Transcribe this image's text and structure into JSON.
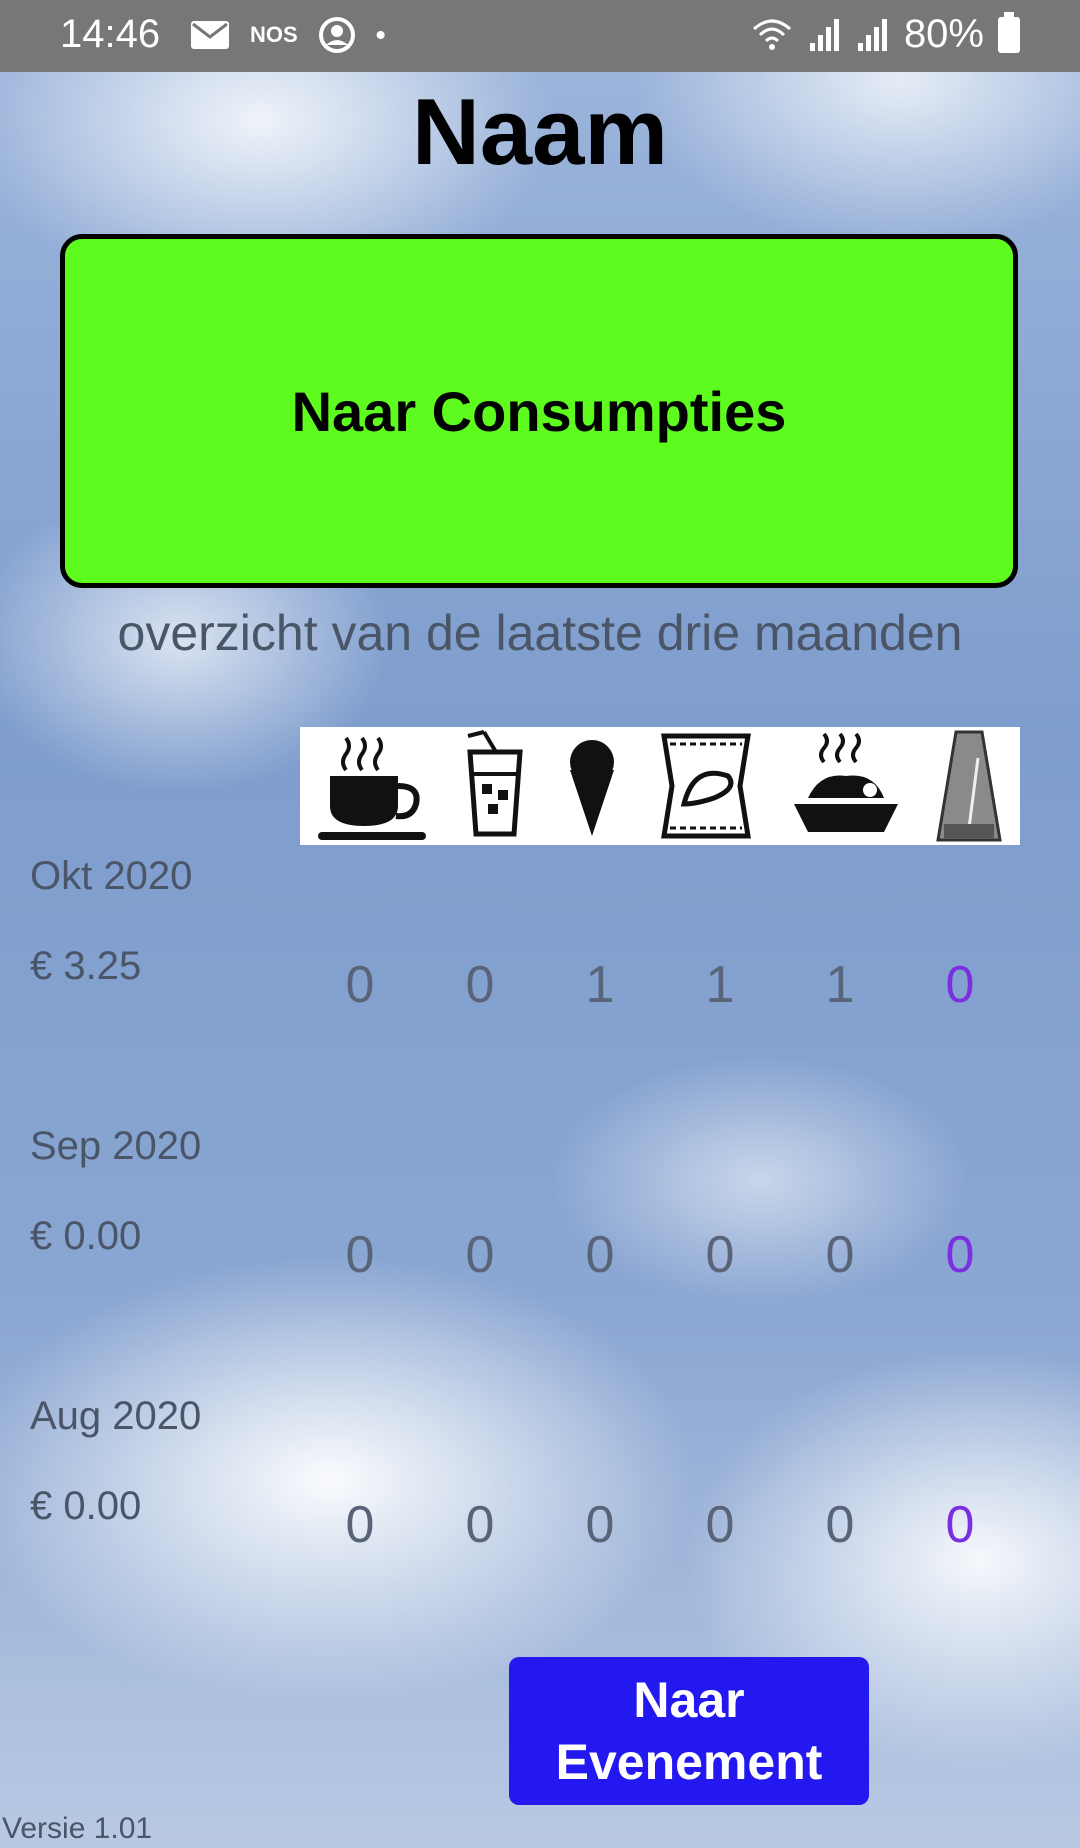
{
  "status_bar": {
    "time": "14:46",
    "carrier": "NOS",
    "battery": "80%",
    "icons": [
      "mail-icon",
      "account-circle-icon",
      "dot-icon",
      "wifi-icon",
      "signal-icon",
      "signal-icon-2",
      "battery-icon"
    ]
  },
  "header": {
    "title": "Naam"
  },
  "consumpties_button": {
    "label": "Naar Consumpties",
    "color": "#5efc1e"
  },
  "overview": {
    "subtitle": "overzicht van de laatste drie maanden",
    "categories": [
      "coffee-icon",
      "drink-icon",
      "ice-cream-icon",
      "chips-icon",
      "meal-icon",
      "metronome-icon"
    ],
    "months": [
      {
        "label": "Okt 2020",
        "amount": "€ 3.25",
        "counts": [
          "0",
          "0",
          "1",
          "1",
          "1",
          "0"
        ]
      },
      {
        "label": "Sep 2020",
        "amount": "€ 0.00",
        "counts": [
          "0",
          "0",
          "0",
          "0",
          "0",
          "0"
        ]
      },
      {
        "label": "Aug 2020",
        "amount": "€ 0.00",
        "counts": [
          "0",
          "0",
          "0",
          "0",
          "0",
          "0"
        ]
      }
    ]
  },
  "evenement_button": {
    "line1": "Naar",
    "line2": "Evenement",
    "color": "#2318f0"
  },
  "footer": {
    "version": "Versie 1.01"
  }
}
